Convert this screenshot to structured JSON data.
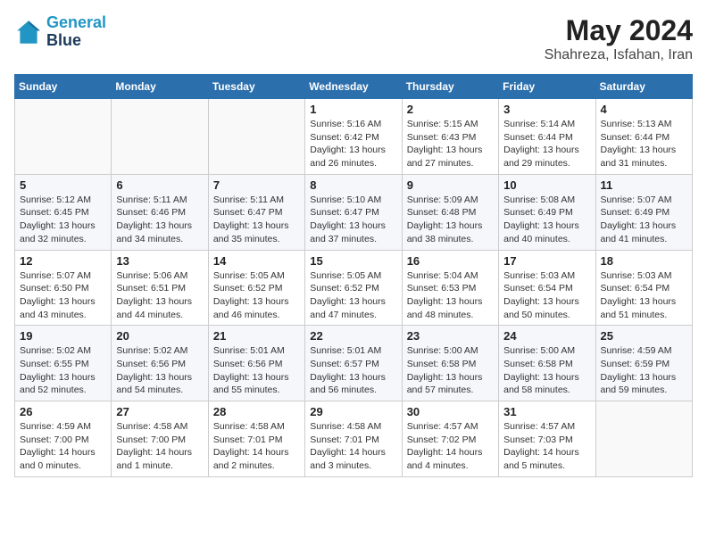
{
  "header": {
    "logo_line1": "General",
    "logo_line2": "Blue",
    "title": "May 2024",
    "subtitle": "Shahreza, Isfahan, Iran"
  },
  "calendar": {
    "weekdays": [
      "Sunday",
      "Monday",
      "Tuesday",
      "Wednesday",
      "Thursday",
      "Friday",
      "Saturday"
    ],
    "weeks": [
      [
        {
          "day": "",
          "info": ""
        },
        {
          "day": "",
          "info": ""
        },
        {
          "day": "",
          "info": ""
        },
        {
          "day": "1",
          "info": "Sunrise: 5:16 AM\nSunset: 6:42 PM\nDaylight: 13 hours\nand 26 minutes."
        },
        {
          "day": "2",
          "info": "Sunrise: 5:15 AM\nSunset: 6:43 PM\nDaylight: 13 hours\nand 27 minutes."
        },
        {
          "day": "3",
          "info": "Sunrise: 5:14 AM\nSunset: 6:44 PM\nDaylight: 13 hours\nand 29 minutes."
        },
        {
          "day": "4",
          "info": "Sunrise: 5:13 AM\nSunset: 6:44 PM\nDaylight: 13 hours\nand 31 minutes."
        }
      ],
      [
        {
          "day": "5",
          "info": "Sunrise: 5:12 AM\nSunset: 6:45 PM\nDaylight: 13 hours\nand 32 minutes."
        },
        {
          "day": "6",
          "info": "Sunrise: 5:11 AM\nSunset: 6:46 PM\nDaylight: 13 hours\nand 34 minutes."
        },
        {
          "day": "7",
          "info": "Sunrise: 5:11 AM\nSunset: 6:47 PM\nDaylight: 13 hours\nand 35 minutes."
        },
        {
          "day": "8",
          "info": "Sunrise: 5:10 AM\nSunset: 6:47 PM\nDaylight: 13 hours\nand 37 minutes."
        },
        {
          "day": "9",
          "info": "Sunrise: 5:09 AM\nSunset: 6:48 PM\nDaylight: 13 hours\nand 38 minutes."
        },
        {
          "day": "10",
          "info": "Sunrise: 5:08 AM\nSunset: 6:49 PM\nDaylight: 13 hours\nand 40 minutes."
        },
        {
          "day": "11",
          "info": "Sunrise: 5:07 AM\nSunset: 6:49 PM\nDaylight: 13 hours\nand 41 minutes."
        }
      ],
      [
        {
          "day": "12",
          "info": "Sunrise: 5:07 AM\nSunset: 6:50 PM\nDaylight: 13 hours\nand 43 minutes."
        },
        {
          "day": "13",
          "info": "Sunrise: 5:06 AM\nSunset: 6:51 PM\nDaylight: 13 hours\nand 44 minutes."
        },
        {
          "day": "14",
          "info": "Sunrise: 5:05 AM\nSunset: 6:52 PM\nDaylight: 13 hours\nand 46 minutes."
        },
        {
          "day": "15",
          "info": "Sunrise: 5:05 AM\nSunset: 6:52 PM\nDaylight: 13 hours\nand 47 minutes."
        },
        {
          "day": "16",
          "info": "Sunrise: 5:04 AM\nSunset: 6:53 PM\nDaylight: 13 hours\nand 48 minutes."
        },
        {
          "day": "17",
          "info": "Sunrise: 5:03 AM\nSunset: 6:54 PM\nDaylight: 13 hours\nand 50 minutes."
        },
        {
          "day": "18",
          "info": "Sunrise: 5:03 AM\nSunset: 6:54 PM\nDaylight: 13 hours\nand 51 minutes."
        }
      ],
      [
        {
          "day": "19",
          "info": "Sunrise: 5:02 AM\nSunset: 6:55 PM\nDaylight: 13 hours\nand 52 minutes."
        },
        {
          "day": "20",
          "info": "Sunrise: 5:02 AM\nSunset: 6:56 PM\nDaylight: 13 hours\nand 54 minutes."
        },
        {
          "day": "21",
          "info": "Sunrise: 5:01 AM\nSunset: 6:56 PM\nDaylight: 13 hours\nand 55 minutes."
        },
        {
          "day": "22",
          "info": "Sunrise: 5:01 AM\nSunset: 6:57 PM\nDaylight: 13 hours\nand 56 minutes."
        },
        {
          "day": "23",
          "info": "Sunrise: 5:00 AM\nSunset: 6:58 PM\nDaylight: 13 hours\nand 57 minutes."
        },
        {
          "day": "24",
          "info": "Sunrise: 5:00 AM\nSunset: 6:58 PM\nDaylight: 13 hours\nand 58 minutes."
        },
        {
          "day": "25",
          "info": "Sunrise: 4:59 AM\nSunset: 6:59 PM\nDaylight: 13 hours\nand 59 minutes."
        }
      ],
      [
        {
          "day": "26",
          "info": "Sunrise: 4:59 AM\nSunset: 7:00 PM\nDaylight: 14 hours\nand 0 minutes."
        },
        {
          "day": "27",
          "info": "Sunrise: 4:58 AM\nSunset: 7:00 PM\nDaylight: 14 hours\nand 1 minute."
        },
        {
          "day": "28",
          "info": "Sunrise: 4:58 AM\nSunset: 7:01 PM\nDaylight: 14 hours\nand 2 minutes."
        },
        {
          "day": "29",
          "info": "Sunrise: 4:58 AM\nSunset: 7:01 PM\nDaylight: 14 hours\nand 3 minutes."
        },
        {
          "day": "30",
          "info": "Sunrise: 4:57 AM\nSunset: 7:02 PM\nDaylight: 14 hours\nand 4 minutes."
        },
        {
          "day": "31",
          "info": "Sunrise: 4:57 AM\nSunset: 7:03 PM\nDaylight: 14 hours\nand 5 minutes."
        },
        {
          "day": "",
          "info": ""
        }
      ]
    ]
  }
}
